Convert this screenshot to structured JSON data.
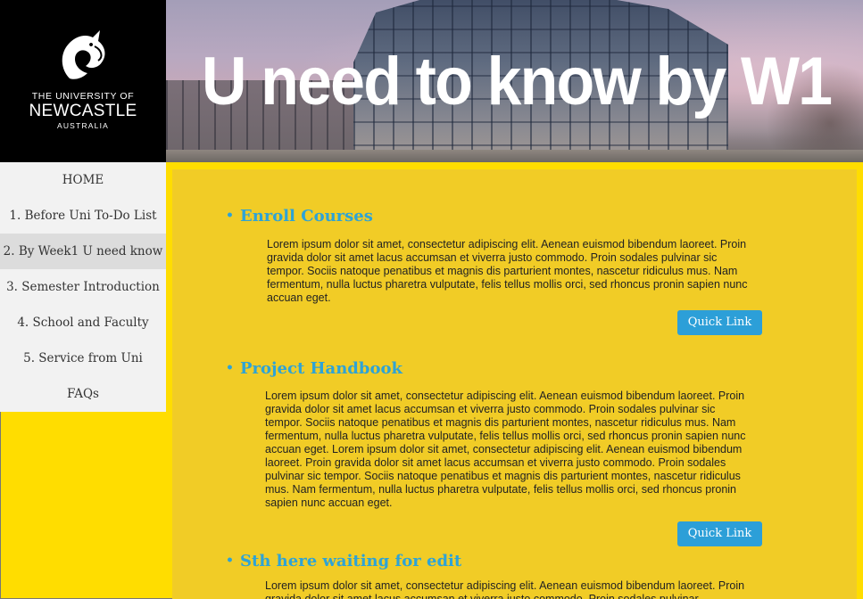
{
  "logo": {
    "line1": "THE UNIVERSITY OF",
    "line2": "NEWCASTLE",
    "line3": "AUSTRALIA",
    "icon": "seahorse-crest-icon"
  },
  "banner": {
    "title": "U need to know by W1"
  },
  "nav": {
    "items": [
      {
        "label": "HOME"
      },
      {
        "label": "1. Before Uni To-Do List"
      },
      {
        "label": "2. By Week1 U need know"
      },
      {
        "label": "3. Semester Introduction"
      },
      {
        "label": "4. School and Faculty"
      },
      {
        "label": "5. Service from Uni"
      },
      {
        "label": "FAQs"
      }
    ],
    "active_index": 2
  },
  "sections": [
    {
      "bullet": "•",
      "title": "Enroll Courses",
      "body": "Lorem ipsum dolor sit amet, consectetur adipiscing elit. Aenean euismod bibendum laoreet. Proin gravida dolor sit amet lacus accumsan et viverra justo commodo. Proin sodales pulvinar sic tempor. Sociis natoque penatibus et magnis dis parturient montes, nascetur ridiculus mus. Nam fermentum, nulla luctus pharetra vulputate, felis tellus mollis orci, sed rhoncus pronin sapien nunc accuan eget.",
      "button": "Quick Link"
    },
    {
      "bullet": "•",
      "title": "Project Handbook",
      "body": "Lorem ipsum dolor sit amet, consectetur adipiscing elit. Aenean euismod bibendum laoreet. Proin gravida dolor sit amet lacus accumsan et viverra justo commodo. Proin sodales pulvinar sic tempor. Sociis natoque penatibus et magnis dis parturient montes, nascetur ridiculus mus. Nam fermentum, nulla luctus pharetra vulputate, felis tellus mollis orci, sed rhoncus pronin sapien nunc accuan eget. Lorem ipsum dolor sit amet, consectetur adipiscing elit. Aenean euismod bibendum laoreet. Proin gravida dolor sit amet lacus accumsan et viverra justo commodo. Proin sodales pulvinar sic tempor. Sociis natoque penatibus et magnis dis parturient montes, nascetur ridiculus mus. Nam fermentum, nulla luctus pharetra vulputate, felis tellus mollis orci, sed rhoncus pronin sapien nunc accuan eget.",
      "button": "Quick Link"
    },
    {
      "bullet": "•",
      "title": "Sth here waiting for edit",
      "body": "Lorem ipsum dolor sit amet, consectetur adipiscing elit. Aenean euismod bibendum laoreet. Proin gravida dolor sit amet lacus accumsan et viverra justo commodo. Proin sodales pulvinar"
    }
  ],
  "colors": {
    "page_background": "#ffdd00",
    "content_background": "#f1cc26",
    "accent": "#2ea3d6",
    "button": "#2c9fd8",
    "sidebar": "#f2f2f2",
    "sidebar_active": "#dcdcdc"
  }
}
